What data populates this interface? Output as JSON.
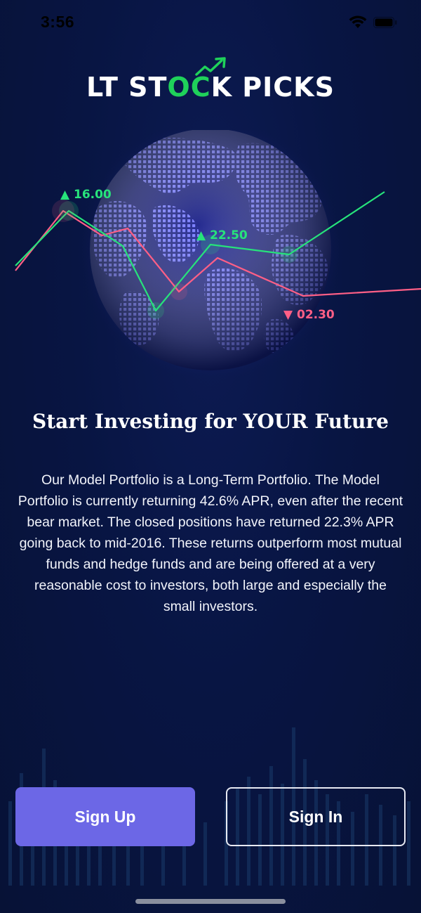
{
  "status_bar": {
    "time": "3:56",
    "icons": [
      "wifi-icon",
      "battery-icon"
    ]
  },
  "logo": {
    "part1": "LT ST",
    "part2": "OC",
    "part3": "K PICKS",
    "accent_color": "#1fd15a"
  },
  "hero": {
    "labels": [
      {
        "text": "▲ 16.00",
        "direction": "up"
      },
      {
        "text": "▲ 22.50",
        "direction": "up"
      },
      {
        "text": "▼ 02.30",
        "direction": "down"
      }
    ],
    "colors": {
      "up": "#27e37b",
      "down": "#ff5f86",
      "globe": "#6f74ff"
    }
  },
  "headline": "Start Investing for YOUR Future",
  "description": "Our Model Portfolio is a Long-Term Portfolio. The Model Portfolio is currently returning 42.6% APR, even after the recent bear market. The closed positions have returned 22.3% APR going back to mid-2016. These returns outperform most mutual funds and hedge funds and are being offered at a very reasonable cost to investors, both large and especially the small investors.",
  "buttons": {
    "sign_up": "Sign Up",
    "sign_in": "Sign In",
    "primary_color": "#6c67e6"
  }
}
